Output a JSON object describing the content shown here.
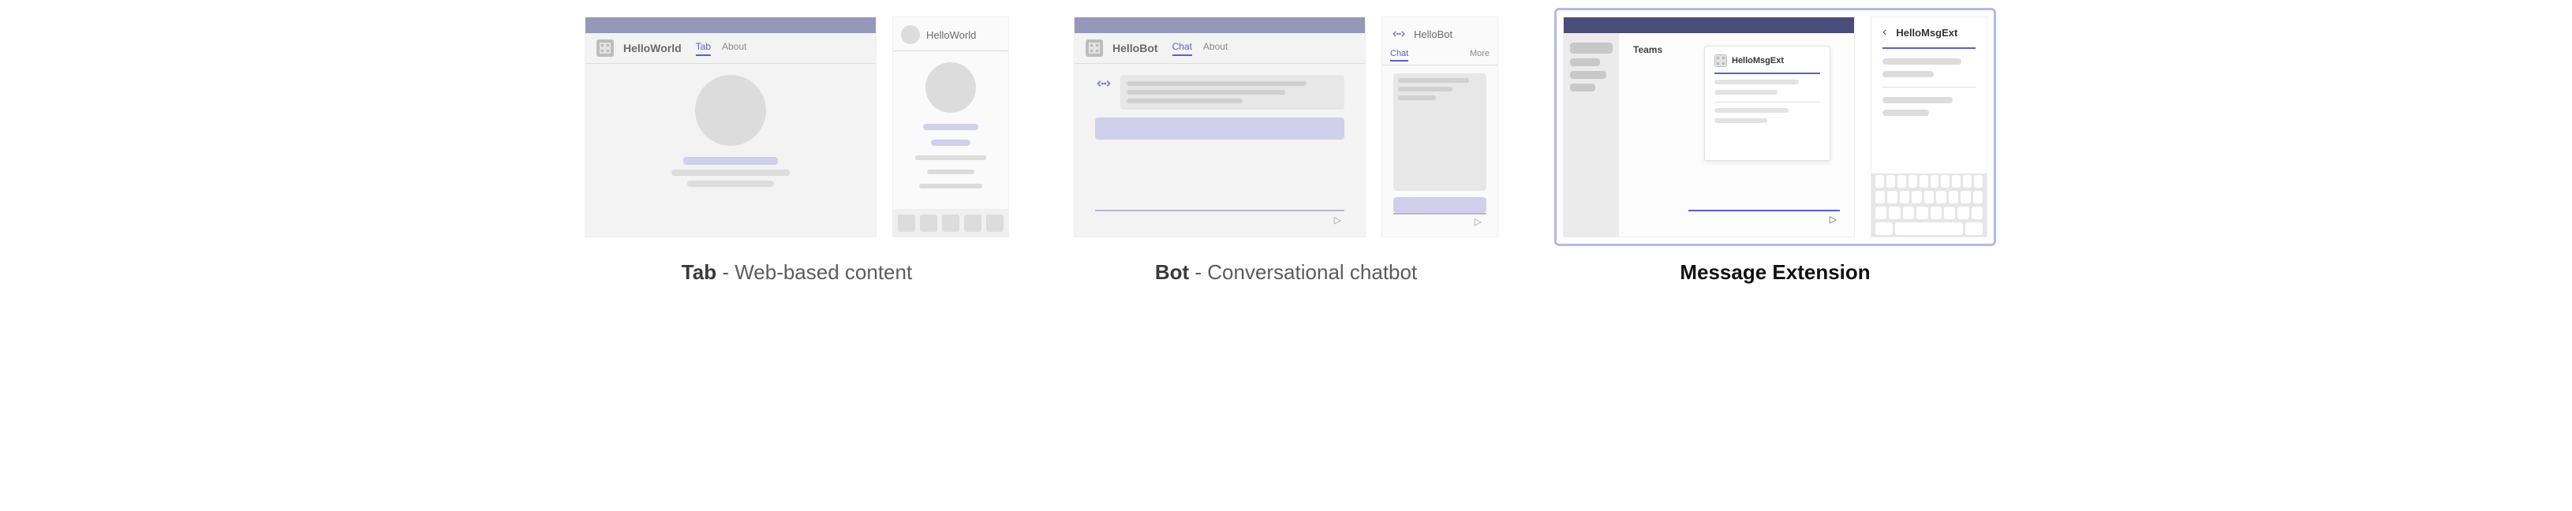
{
  "tab": {
    "desktop": {
      "app_name": "HelloWorld",
      "tab1": "Tab",
      "tab2": "About"
    },
    "mobile": {
      "title": "HelloWorld"
    },
    "caption_bold": "Tab",
    "caption_rest": " - Web-based content"
  },
  "bot": {
    "desktop": {
      "app_name": "HelloBot",
      "tab1": "Chat",
      "tab2": "About"
    },
    "mobile": {
      "title": "HelloBot",
      "tab1": "Chat",
      "tab2": "More"
    },
    "caption_bold": "Bot",
    "caption_rest": " - Conversational chatbot"
  },
  "msgext": {
    "desktop": {
      "sidebar_label": "Teams",
      "flyout_title": "HelloMsgExt"
    },
    "mobile": {
      "title": "HelloMsgExt"
    },
    "caption": "Message Extension"
  }
}
